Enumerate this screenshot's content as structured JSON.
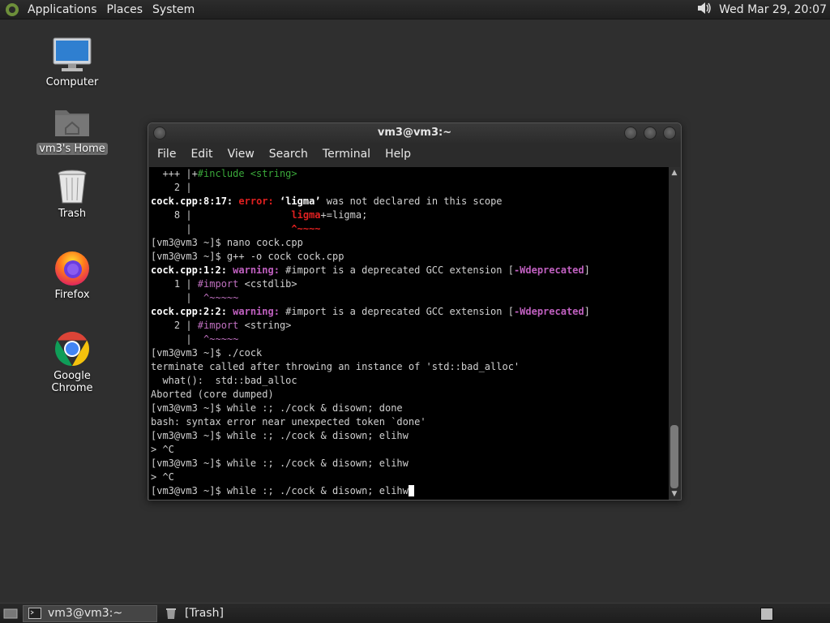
{
  "top_panel": {
    "menus": [
      "Applications",
      "Places",
      "System"
    ],
    "clock": "Wed Mar 29, 20:07"
  },
  "desktop_icons": [
    {
      "label": "Computer",
      "icon": "computer-icon"
    },
    {
      "label": "vm3's Home",
      "icon": "home-folder-icon"
    },
    {
      "label": "Trash",
      "icon": "trash-icon"
    },
    {
      "label": "Firefox",
      "icon": "firefox-icon"
    },
    {
      "label": "Google Chrome",
      "icon": "chrome-icon"
    }
  ],
  "window": {
    "title": "vm3@vm3:~",
    "menus": [
      "File",
      "Edit",
      "View",
      "Search",
      "Terminal",
      "Help"
    ]
  },
  "terminal": {
    "lines": [
      "  +++ |+#include <string>",
      "    2 |",
      "cock.cpp:8:17: error: ‘ligma’ was not declared in this scope",
      "    8 |                 ligma+=ligma;",
      "      |                 ^~~~~",
      "[vm3@vm3 ~]$ nano cock.cpp",
      "[vm3@vm3 ~]$ g++ -o cock cock.cpp",
      "cock.cpp:1:2: warning: #import is a deprecated GCC extension [-Wdeprecated]",
      "    1 | #import <cstdlib>",
      "      |  ^~~~~~",
      "cock.cpp:2:2: warning: #import is a deprecated GCC extension [-Wdeprecated]",
      "    2 | #import <string>",
      "      |  ^~~~~~",
      "[vm3@vm3 ~]$ ./cock",
      "terminate called after throwing an instance of 'std::bad_alloc'",
      "  what():  std::bad_alloc",
      "Aborted (core dumped)",
      "[vm3@vm3 ~]$ while :; ./cock & disown; done",
      "bash: syntax error near unexpected token `done'",
      "[vm3@vm3 ~]$ while :; ./cock & disown; elihw",
      "> ^C",
      "[vm3@vm3 ~]$ while :; ./cock & disown; elihw",
      "> ^C",
      "[vm3@vm3 ~]$ while :; ./cock & disown; elihw"
    ]
  },
  "taskbar": {
    "tasks": [
      "vm3@vm3:~",
      "[Trash]"
    ]
  }
}
